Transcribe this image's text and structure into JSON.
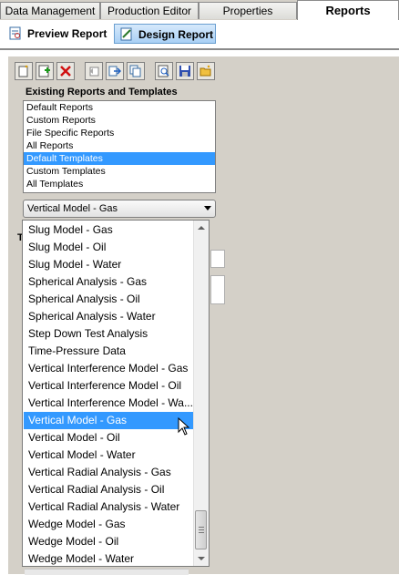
{
  "tabs": [
    {
      "label": "Data Management"
    },
    {
      "label": "Production Editor"
    },
    {
      "label": "Properties"
    },
    {
      "label": "Reports"
    }
  ],
  "subtabs": [
    {
      "label": "Preview Report"
    },
    {
      "label": "Design Report"
    }
  ],
  "toolbar": {
    "icons": [
      "new-report-icon",
      "add-icon",
      "delete-icon",
      "undo-icon",
      "export-icon",
      "copy-icon",
      "preview-icon",
      "save-icon",
      "open-folder-icon"
    ]
  },
  "existing": {
    "title": "Existing Reports and Templates",
    "items": [
      "Default Reports",
      "Custom Reports",
      "File Specific Reports",
      "All Reports",
      "Default Templates",
      "Custom Templates",
      "All Templates"
    ],
    "selected": "Default Templates"
  },
  "combo": {
    "value": "Vertical Model - Gas"
  },
  "background_label": "T",
  "dropdown": {
    "options": [
      "Slug Model - Gas",
      "Slug Model - Oil",
      "Slug Model - Water",
      "Spherical Analysis - Gas",
      "Spherical Analysis - Oil",
      "Spherical Analysis - Water",
      "Step Down Test Analysis",
      "Time-Pressure Data",
      "Vertical Interference Model - Gas",
      "Vertical Interference Model - Oil",
      "Vertical Interference Model - Wa...",
      "Vertical Model - Gas",
      "Vertical Model - Oil",
      "Vertical Model - Water",
      "Vertical Radial Analysis - Gas",
      "Vertical Radial Analysis - Oil",
      "Vertical Radial Analysis - Water",
      "Wedge Model - Gas",
      "Wedge Model - Oil",
      "Wedge Model - Water"
    ],
    "highlighted": "Vertical Model - Gas"
  },
  "colors": {
    "selection": "#3399ff",
    "panel": "#d4d0c8"
  }
}
